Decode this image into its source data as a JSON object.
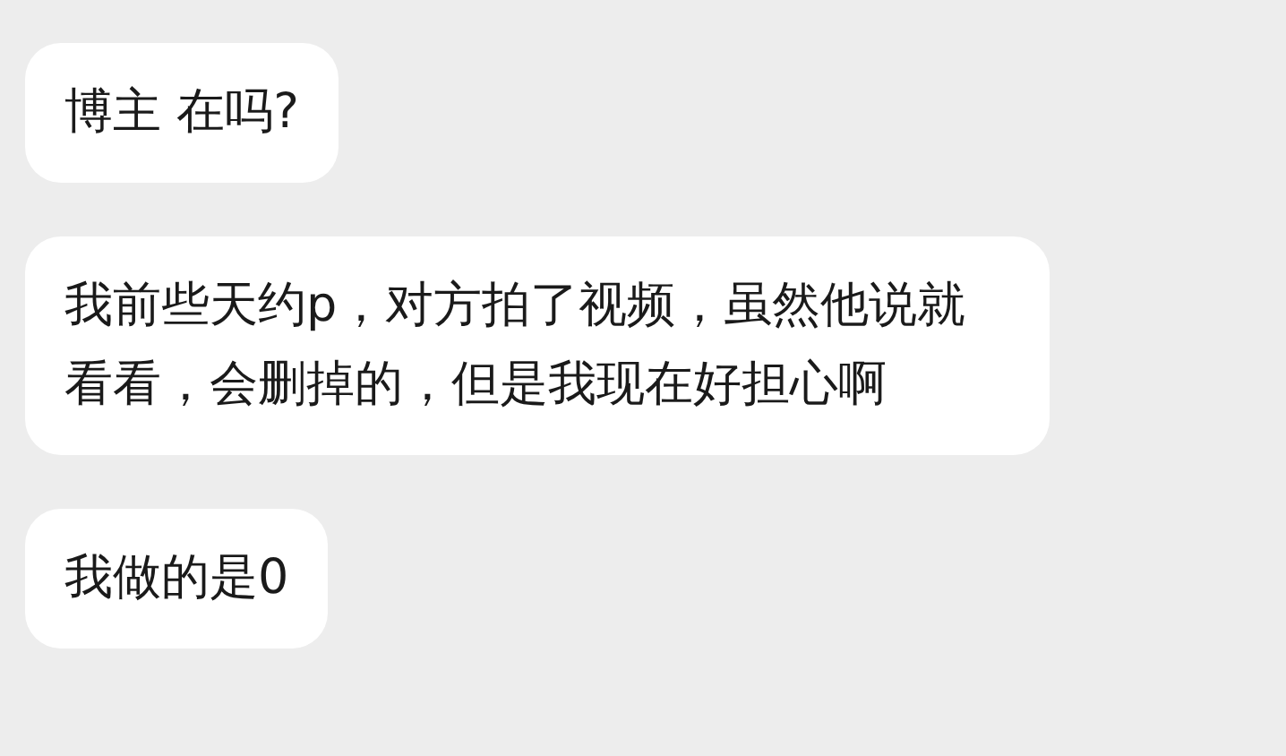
{
  "messages": [
    {
      "text": "博主 在吗?"
    },
    {
      "text": "我前些天约p，对方拍了视频，虽然他说就看看，会删掉的，但是我现在好担心啊"
    },
    {
      "text": "我做的是0"
    }
  ]
}
